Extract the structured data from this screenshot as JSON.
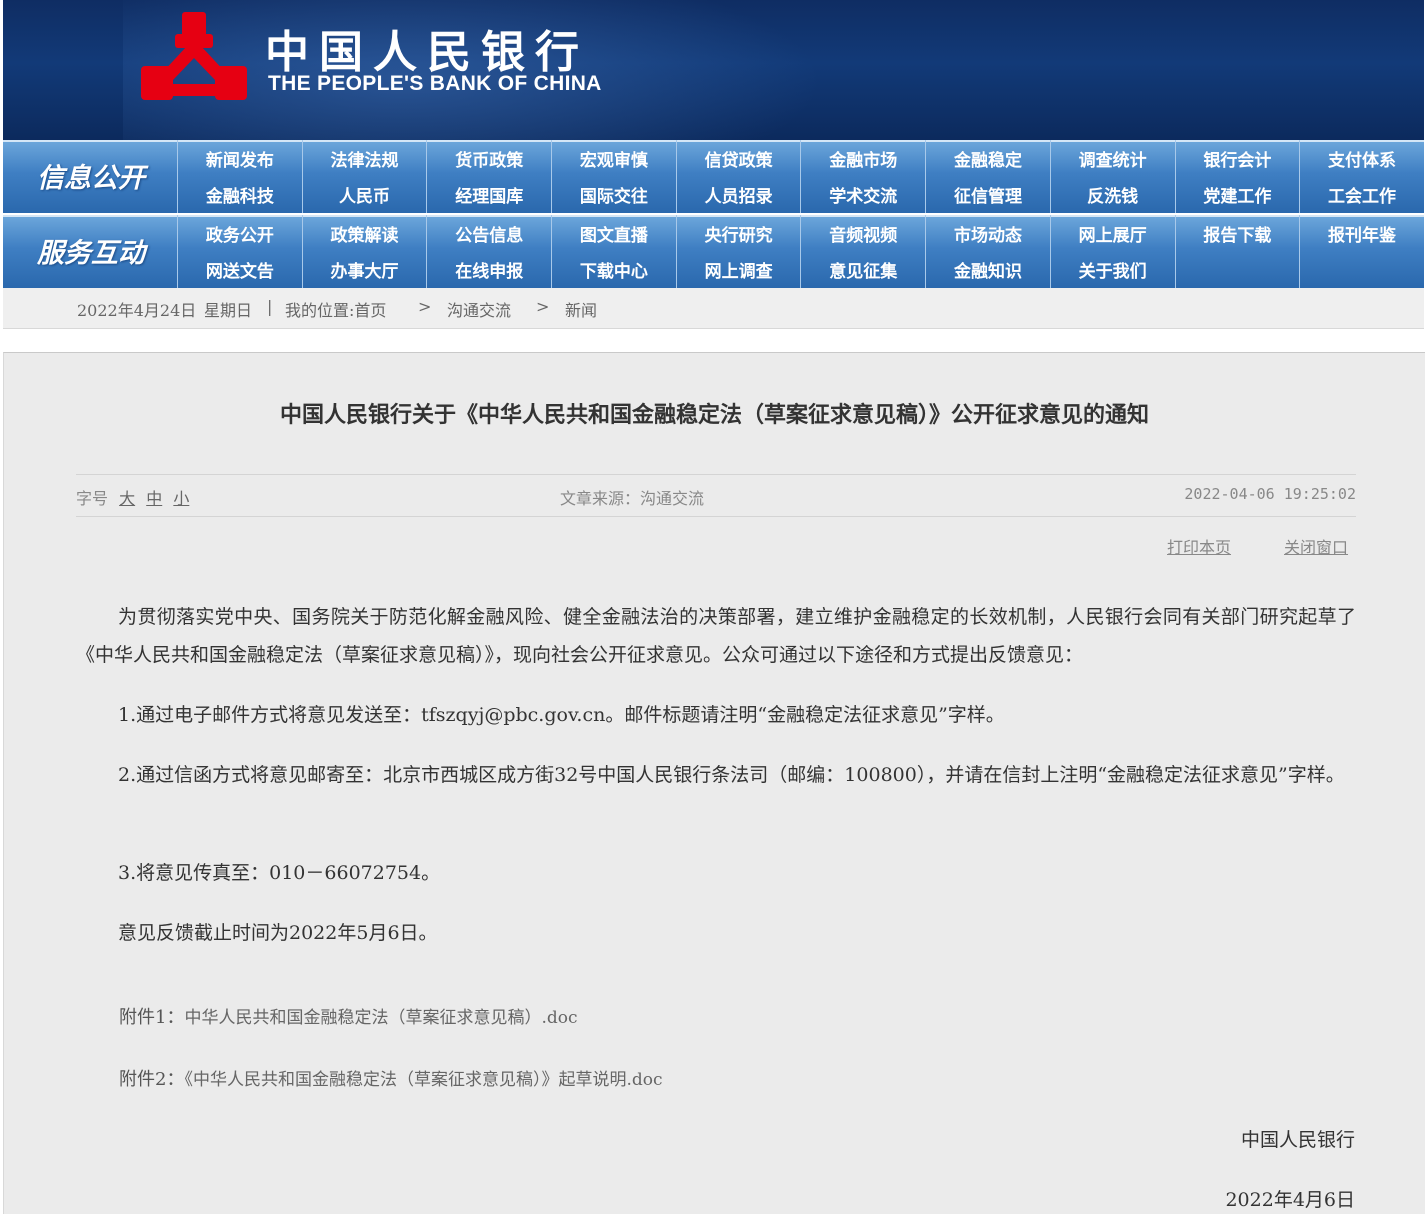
{
  "header": {
    "logo_cn": "中国人民银行",
    "logo_en": "THE PEOPLE'S BANK OF CHINA"
  },
  "nav": {
    "info_label": "信息公开",
    "service_label": "服务互动",
    "info_row1": [
      "新闻发布",
      "法律法规",
      "货币政策",
      "宏观审慎",
      "信贷政策",
      "金融市场",
      "金融稳定",
      "调查统计",
      "银行会计",
      "支付体系"
    ],
    "info_row2": [
      "金融科技",
      "人民币",
      "经理国库",
      "国际交往",
      "人员招录",
      "学术交流",
      "征信管理",
      "反洗钱",
      "党建工作",
      "工会工作"
    ],
    "service_row1": [
      "政务公开",
      "政策解读",
      "公告信息",
      "图文直播",
      "央行研究",
      "音频视频",
      "市场动态",
      "网上展厅",
      "报告下载",
      "报刊年鉴"
    ],
    "service_row2": [
      "网送文告",
      "办事大厅",
      "在线申报",
      "下载中心",
      "网上调查",
      "意见征集",
      "金融知识",
      "关于我们",
      "",
      ""
    ]
  },
  "breadcrumb": {
    "date": "2022年4月24日",
    "weekday": "星期日",
    "divider": "|",
    "location_label": "我的位置:首页",
    "arrow": ">",
    "level1": "沟通交流",
    "level2": "新闻"
  },
  "article": {
    "title": "中国人民银行关于《中华人民共和国金融稳定法（草案征求意见稿）》公开征求意见的通知",
    "font_size_label": "字号",
    "font_large": "大",
    "font_medium": "中",
    "font_small": "小",
    "source": "文章来源：沟通交流",
    "datetime": "2022-04-06 19:25:02",
    "print_label": "打印本页",
    "close_label": "关闭窗口",
    "paragraph1": "为贯彻落实党中央、国务院关于防范化解金融风险、健全金融法治的决策部署，建立维护金融稳定的长效机制，人民银行会同有关部门研究起草了《中华人民共和国金融稳定法（草案征求意见稿）》，现向社会公开征求意见。公众可通过以下途径和方式提出反馈意见：",
    "item1": "1.通过电子邮件方式将意见发送至：tfszqyj@pbc.gov.cn。邮件标题请注明“金融稳定法征求意见”字样。",
    "item2": "2.通过信函方式将意见邮寄至：北京市西城区成方街32号中国人民银行条法司（邮编：100800），并请在信封上注明“金融稳定法征求意见”字样。",
    "item3": "3.将意见传真至：010－66072754。",
    "deadline": "意见反馈截止时间为2022年5月6日。",
    "attach1_label": "附件1：",
    "attach1_name": "中华人民共和国金融稳定法（草案征求意见稿）.doc",
    "attach2_label": "附件2：",
    "attach2_name": "《中华人民共和国金融稳定法（草案征求意见稿）》起草说明.doc",
    "signature": "中国人民银行",
    "sign_date": "2022年4月6日"
  },
  "colors": {
    "header_bg": "#123a78",
    "nav_bg": "#3f7fc3",
    "emblem_red": "#e60012",
    "panel_bg": "#ebebeb"
  }
}
